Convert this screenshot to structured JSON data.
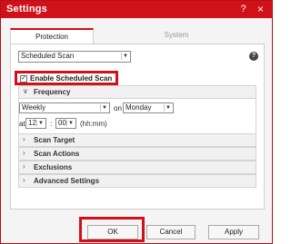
{
  "window": {
    "title": "Settings",
    "help_glyph": "?",
    "close_glyph": "×"
  },
  "tabs": [
    {
      "label": "Protection",
      "active": true
    },
    {
      "label": "System",
      "active": false
    }
  ],
  "scan_type": {
    "value": "Scheduled Scan"
  },
  "help_icon_glyph": "?",
  "enable": {
    "label": "Enable Scheduled Scan",
    "checked": true,
    "check_glyph": "✓"
  },
  "sections": {
    "frequency": "Frequency",
    "scan_target": "Scan Target",
    "scan_actions": "Scan Actions",
    "exclusions": "Exclusions",
    "advanced": "Advanced Settings"
  },
  "frequency": {
    "period_value": "Weekly",
    "on_label": "on",
    "day_value": "Monday",
    "at_label": "at",
    "hour_value": "12",
    "colon": ":",
    "minute_value": "00",
    "format_hint": "(hh:mm)"
  },
  "buttons": {
    "ok": "OK",
    "cancel": "Cancel",
    "apply": "Apply"
  },
  "colors": {
    "accent": "#d01119",
    "panel": "#ffffff",
    "background": "#f4f4f4"
  }
}
